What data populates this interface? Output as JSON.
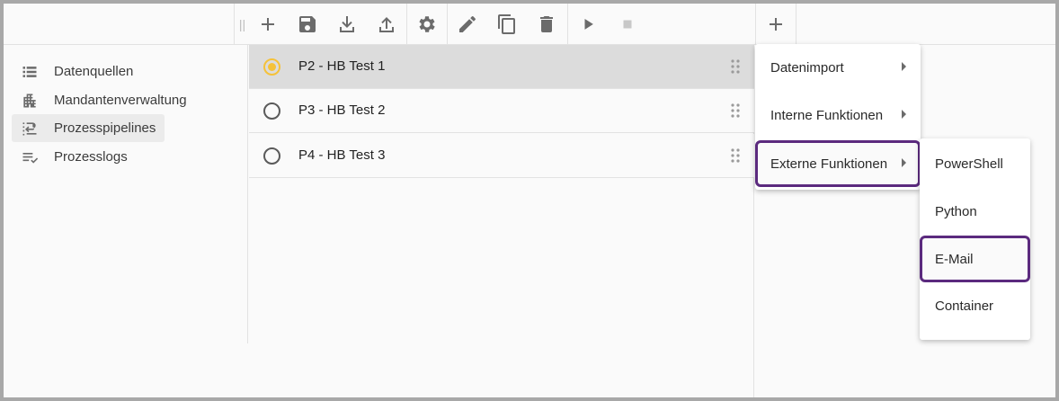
{
  "toolbar": {
    "grip": "||",
    "buttons": [
      {
        "name": "add",
        "icon": "plus-icon"
      },
      {
        "name": "save",
        "icon": "save-icon"
      },
      {
        "name": "import",
        "icon": "download-icon"
      },
      {
        "name": "export",
        "icon": "upload-icon"
      },
      {
        "name": "settings",
        "icon": "gear-icon"
      },
      {
        "name": "edit",
        "icon": "pencil-icon"
      },
      {
        "name": "copy",
        "icon": "copy-icon"
      },
      {
        "name": "delete",
        "icon": "trash-icon"
      },
      {
        "name": "run",
        "icon": "play-icon"
      },
      {
        "name": "stop",
        "icon": "stop-icon"
      }
    ]
  },
  "sidebar": {
    "items": [
      {
        "label": "Datenquellen",
        "icon": "list-icon"
      },
      {
        "label": "Mandantenverwaltung",
        "icon": "buildings-icon"
      },
      {
        "label": "Prozesspipelines",
        "icon": "pipeline-icon"
      },
      {
        "label": "Prozesslogs",
        "icon": "playlist-check-icon"
      }
    ],
    "active_index": 2
  },
  "pipelines": [
    {
      "label": "P2 - HB Test 1",
      "selected": true
    },
    {
      "label": "P3 - HB Test 2",
      "selected": false
    },
    {
      "label": "P4 - HB Test 3",
      "selected": false
    }
  ],
  "menu": {
    "items": [
      {
        "label": "Datenimport"
      },
      {
        "label": "Interne Funktionen"
      },
      {
        "label": "Externe Funktionen"
      }
    ]
  },
  "submenu": {
    "items": [
      {
        "label": "PowerShell"
      },
      {
        "label": "Python"
      },
      {
        "label": "E-Mail"
      },
      {
        "label": "Container"
      }
    ]
  },
  "colors": {
    "accent_radio": "#f5c23a",
    "highlight_border": "#5b2a7e"
  }
}
